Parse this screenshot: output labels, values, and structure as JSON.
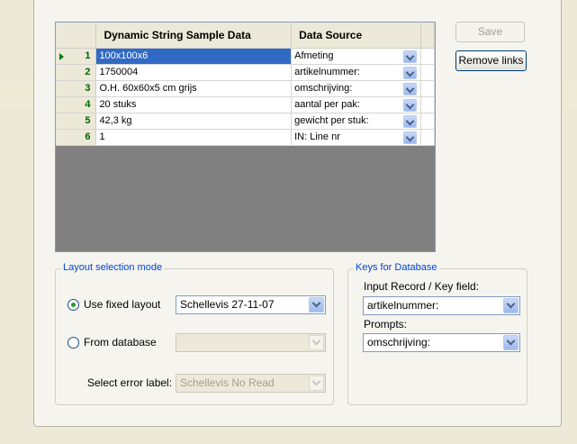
{
  "grid": {
    "columns": [
      "Dynamic String Sample Data",
      "Data Source"
    ],
    "rows": [
      {
        "num": "1",
        "sample": "100x100x6",
        "source": "Afmeting",
        "current": true
      },
      {
        "num": "2",
        "sample": "1750004",
        "source": "artikelnummer:"
      },
      {
        "num": "3",
        "sample": "O.H. 60x60x5 cm grijs",
        "source": "omschrijving:"
      },
      {
        "num": "4",
        "sample": "20 stuks",
        "source": "aantal per pak:"
      },
      {
        "num": "5",
        "sample": "42,3 kg",
        "source": "gewicht per stuk:"
      },
      {
        "num": "6",
        "sample": "1",
        "source": "IN: Line nr"
      }
    ]
  },
  "buttons": {
    "save": "Save",
    "remove_links": "Remove links"
  },
  "layout_selection": {
    "title": "Layout selection mode",
    "use_fixed_label": "Use fixed layout",
    "use_fixed_value": "Schellevis 27-11-07",
    "from_db_label": "From database",
    "from_db_value": "",
    "error_label": "Select error label:",
    "error_value": "Schellevis No Read",
    "selected_option": "Use fixed layout"
  },
  "keys": {
    "title": "Keys for Database",
    "input_label": "Input Record / Key field:",
    "input_value": "artikelnummer:",
    "prompts_label": "Prompts:",
    "prompts_value": "omschrijving:"
  },
  "colors": {
    "selection": "#316ac5",
    "row_number": "#006400",
    "group_title": "#0046d5"
  }
}
